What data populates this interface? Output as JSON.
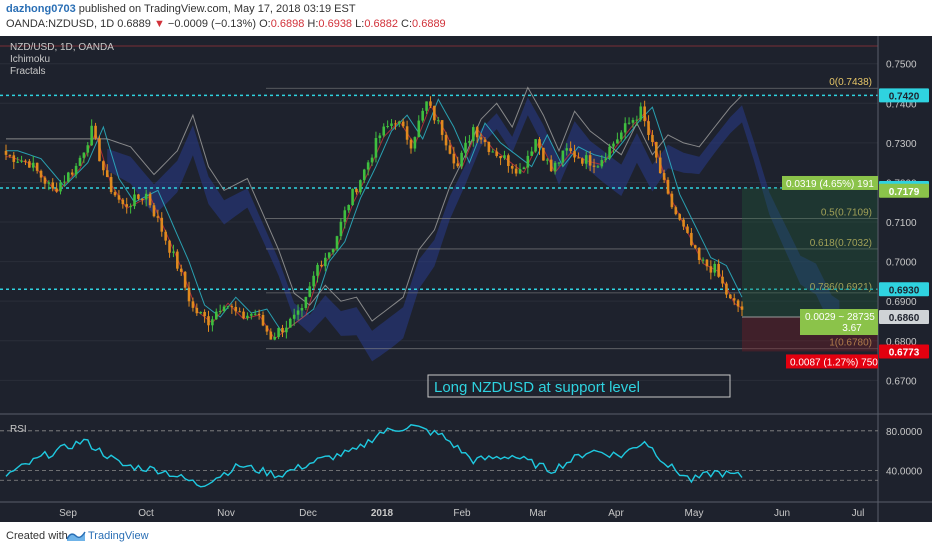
{
  "header": {
    "author": "dazhong0703",
    "published_text": " published on TradingView.com, May 17, 2018 03:19 EST",
    "symbol": "OANDA:NZDUSD, 1D",
    "last": "0.6889",
    "change": "−0.0009 (−0.13%)",
    "o_label": "O:",
    "o": "0.6898",
    "h_label": "H:",
    "h": "0.6938",
    "l_label": "L:",
    "l": "0.6882",
    "c_label": "C:",
    "c": "0.6889"
  },
  "legend": {
    "symbol": "NZD/USD, 1D, OANDA",
    "ichimoku": "Ichimoku",
    "fractals": "Fractals"
  },
  "annotation": {
    "text": "Long NZDUSD at support level"
  },
  "rsi_label": "RSI",
  "footer": {
    "created": "Created with",
    "brand": "TradingView"
  },
  "colors": {
    "background": "#1e222d",
    "candle_up": "#3fbf3f",
    "candle_down": "#e08a1e",
    "cloud_bull": "#5a2f6e",
    "cloud_bear": "#283a8a",
    "fib": "#e5c568",
    "level_cyan": "#2fd3e0",
    "rsi": "#1fc9e0",
    "red_label": "#e3000f",
    "green_label": "#8bc34a"
  },
  "chart_data": [
    {
      "type": "line",
      "title": "NZD/USD, 1D, OANDA",
      "ylim": [
        0.662,
        0.757
      ],
      "y_ticks": [
        "0.7500",
        "0.7400",
        "0.7300",
        "0.7200",
        "0.7100",
        "0.7000",
        "0.6900",
        "0.6800",
        "0.6700"
      ],
      "x_ticks": [
        "Sep",
        "Oct",
        "Nov",
        "Dec",
        "2018",
        "Feb",
        "Mar",
        "Apr",
        "May",
        "Jun",
        "Jul"
      ],
      "series": [
        {
          "x": [
            "Sep",
            "Oct",
            "Nov",
            "Dec",
            "2018",
            "Feb",
            "Mar",
            "Apr",
            "May"
          ],
          "values": [
            0.72,
            0.718,
            0.686,
            0.686,
            0.707,
            0.731,
            0.723,
            0.733,
            0.688
          ]
        }
      ],
      "fib_levels": [
        {
          "label": "0(0.7438)",
          "value": 0.7438
        },
        {
          "label": "0.5(0.7109)",
          "value": 0.7109
        },
        {
          "label": "0.618(0.7032)",
          "value": 0.7032
        },
        {
          "label": "0.786(0.6921)",
          "value": 0.6921
        },
        {
          "label": "1(0.6780)",
          "value": 0.678
        }
      ],
      "price_labels": [
        {
          "text": "0.7420",
          "value": 0.742,
          "style": "cyan"
        },
        {
          "text": "0.7186",
          "value": 0.7186,
          "style": "cyan"
        },
        {
          "text": "0.7179",
          "value": 0.7179,
          "style": "green"
        },
        {
          "text": "0.6930",
          "value": 0.693,
          "style": "cyan"
        },
        {
          "text": "0.6860",
          "value": 0.686,
          "style": "gray"
        },
        {
          "text": "0.6773",
          "value": 0.6773,
          "style": "red"
        }
      ],
      "position_labels": {
        "target": "0.0319 (4.65%) 191",
        "entry": "0.0029 ~ 28735",
        "ratio": "3.67",
        "stop": "0.0087 (1.27%) 750"
      }
    },
    {
      "type": "line",
      "title": "RSI",
      "y_ticks": [
        "80.0000",
        "40.0000"
      ],
      "ylim": [
        10,
        95
      ],
      "series": [
        {
          "x": [
            "Sep",
            "Oct",
            "Nov",
            "Dec",
            "2018",
            "Feb",
            "Mar",
            "Apr",
            "May"
          ],
          "values": [
            35,
            65,
            30,
            45,
            80,
            55,
            40,
            65,
            30
          ]
        }
      ]
    }
  ]
}
